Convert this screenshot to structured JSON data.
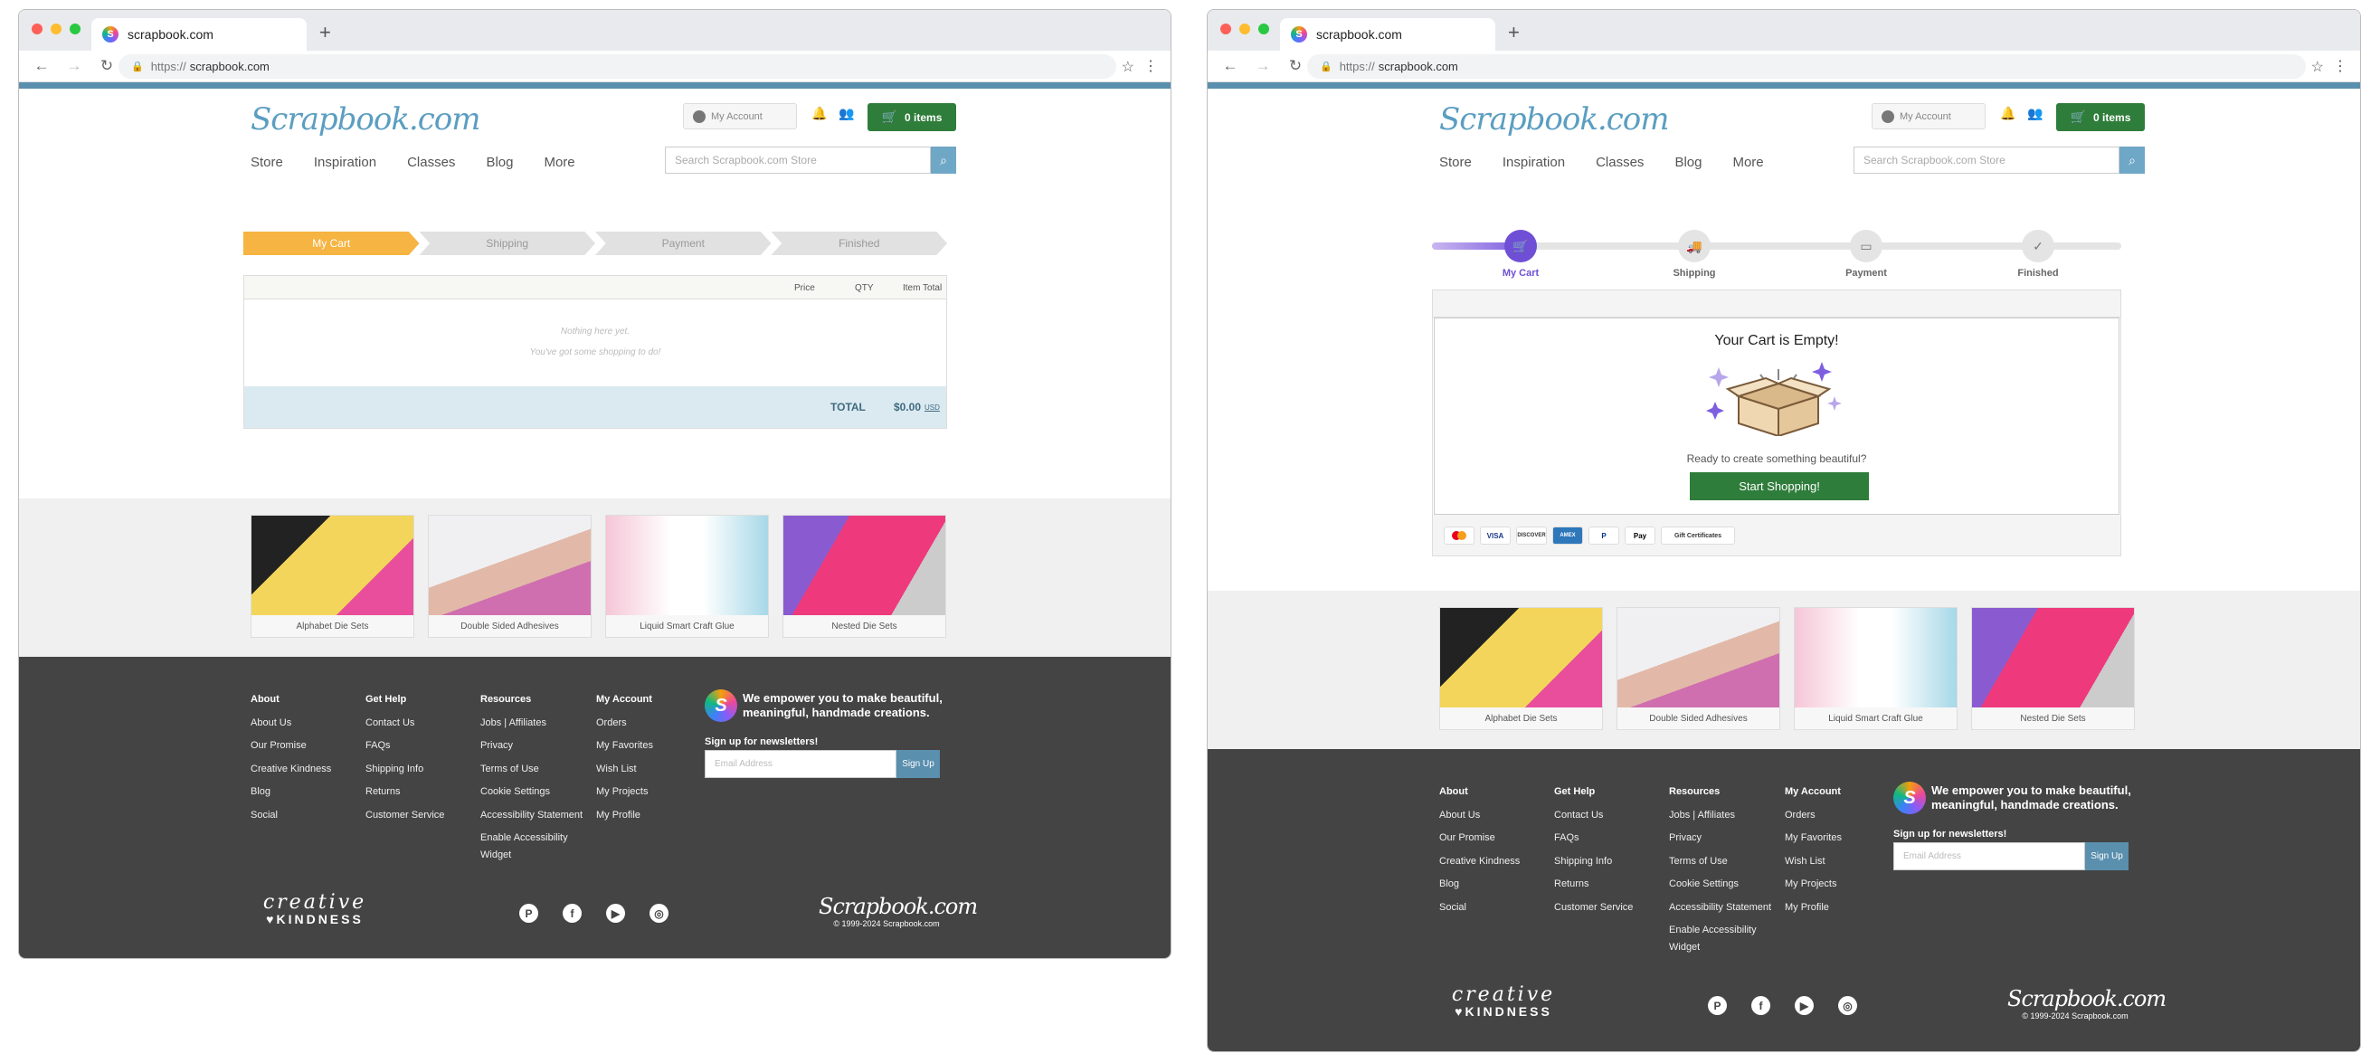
{
  "browser": {
    "tab_title": "scrapbook.com",
    "new_tab": "+",
    "url_protocol": "https://",
    "url_domain": "scrapbook.com",
    "traffic_colors": [
      "#fe5f57",
      "#febc2e",
      "#28c840"
    ]
  },
  "header": {
    "logo": "Scrapbook.com",
    "my_account": "My Account",
    "cart_label": "0 items",
    "nav": [
      "Store",
      "Inspiration",
      "Classes",
      "Blog",
      "More"
    ],
    "search_placeholder": "Search Scrapbook.com Store"
  },
  "cart_v1": {
    "steps": [
      "My Cart",
      "Shipping",
      "Payment",
      "Finished"
    ],
    "active_step": 0,
    "columns": [
      "Price",
      "QTY",
      "Item Total"
    ],
    "empty_line1": "Nothing here yet.",
    "empty_line2": "You've got some shopping to do!",
    "total_label": "TOTAL",
    "total_value": "$0.00",
    "currency": "USD"
  },
  "cart_v2": {
    "steps": [
      "My Cart",
      "Shipping",
      "Payment",
      "Finished"
    ],
    "active_step": 0,
    "empty_title": "Your Cart is Empty!",
    "empty_sub": "Ready to create something beautiful?",
    "start_button": "Start Shopping!",
    "payment_methods": [
      "Mastercard",
      "VISA",
      "DISCOVER",
      "AMEX",
      "PayPal",
      "Apple Pay",
      "Gift Certificates"
    ]
  },
  "products": [
    {
      "name": "Alphabet Die Sets"
    },
    {
      "name": "Double Sided Adhesives"
    },
    {
      "name": "Liquid Smart Craft Glue"
    },
    {
      "name": "Nested Die Sets"
    }
  ],
  "footer": {
    "columns": [
      {
        "heading": "About",
        "links": [
          "About Us",
          "Our Promise",
          "Creative Kindness",
          "Blog",
          "Social"
        ]
      },
      {
        "heading": "Get Help",
        "links": [
          "Contact Us",
          "FAQs",
          "Shipping Info",
          "Returns",
          "Customer Service"
        ]
      },
      {
        "heading": "Resources",
        "links": [
          "Jobs | Affiliates",
          "Privacy",
          "Terms of Use",
          "Cookie Settings",
          "Accessibility Statement",
          "Enable Accessibility",
          "Widget"
        ]
      },
      {
        "heading": "My Account",
        "links": [
          "Orders",
          "My Favorites",
          "Wish List",
          "My Projects",
          "My Profile"
        ]
      }
    ],
    "empower_line1": "We empower you to make beautiful,",
    "empower_line2": "meaningful, handmade creations.",
    "newsletter_label": "Sign up for newsletters!",
    "email_placeholder": "Email Address",
    "signup_button": "Sign Up",
    "ck_line1": "creative",
    "ck_line2": "♥KINDNESS",
    "footer_logo": "Scrapbook.com",
    "copyright": "© 1999-2024 Scrapbook.com",
    "social_icons": [
      "pinterest-icon",
      "facebook-icon",
      "youtube-icon",
      "instagram-icon"
    ]
  }
}
